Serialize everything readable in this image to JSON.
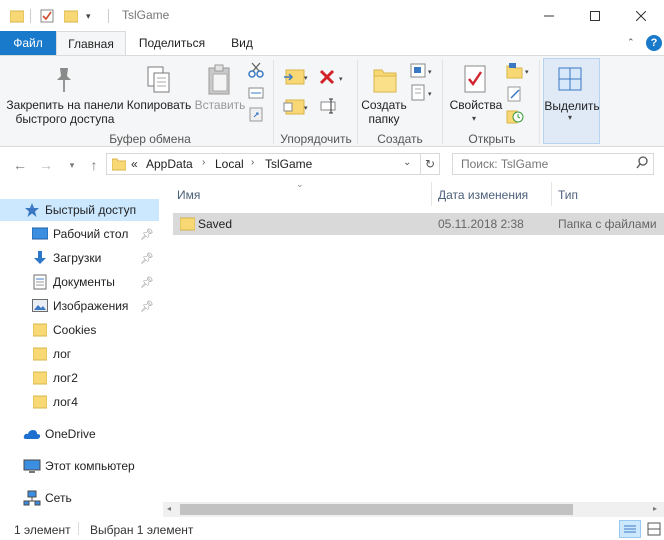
{
  "window": {
    "title": "TslGame"
  },
  "ribbon_tabs": [
    "Файл",
    "Главная",
    "Поделиться",
    "Вид"
  ],
  "ribbon": {
    "clipboard": {
      "pin_label": "Закрепить на панели быстрого доступа",
      "pin_line1": "Закрепить на панели",
      "pin_line2": "быстрого доступа",
      "copy_label": "Копировать",
      "paste_label": "Вставить",
      "group_label": "Буфер обмена"
    },
    "organize": {
      "group_label": "Упорядочить"
    },
    "create": {
      "new_folder_line1": "Создать",
      "new_folder_line2": "папку",
      "group_label": "Создать"
    },
    "open": {
      "properties_label": "Свойства",
      "group_label": "Открыть"
    },
    "select": {
      "select_label": "Выделить"
    }
  },
  "address": {
    "overflow": "«",
    "crumbs": [
      "AppData",
      "Local",
      "TslGame"
    ],
    "search_placeholder": "Поиск: TslGame"
  },
  "nav": {
    "quick_access": "Быстрый доступ",
    "items": [
      {
        "label": "Рабочий стол",
        "icon": "desktop-icon",
        "pinned": true
      },
      {
        "label": "Загрузки",
        "icon": "downloads-icon",
        "pinned": true
      },
      {
        "label": "Документы",
        "icon": "documents-icon",
        "pinned": true
      },
      {
        "label": "Изображения",
        "icon": "pictures-icon",
        "pinned": true
      },
      {
        "label": "Cookies",
        "icon": "folder-icon",
        "pinned": false
      },
      {
        "label": "лог",
        "icon": "folder-icon",
        "pinned": false
      },
      {
        "label": "лог2",
        "icon": "folder-icon",
        "pinned": false
      },
      {
        "label": "лог4",
        "icon": "folder-icon",
        "pinned": false
      }
    ],
    "onedrive": "OneDrive",
    "this_pc": "Этот компьютер",
    "network": "Сеть"
  },
  "columns": {
    "name": "Имя",
    "date": "Дата изменения",
    "type": "Тип"
  },
  "files": [
    {
      "name": "Saved",
      "date": "05.11.2018 2:38",
      "type": "Папка с файлами"
    }
  ],
  "status": {
    "count": "1 элемент",
    "selected": "Выбран 1 элемент"
  },
  "colors": {
    "accent": "#1979ca",
    "selection": "#cce8ff",
    "row_selected": "#d9d9d9",
    "folder": "#f8d775"
  }
}
